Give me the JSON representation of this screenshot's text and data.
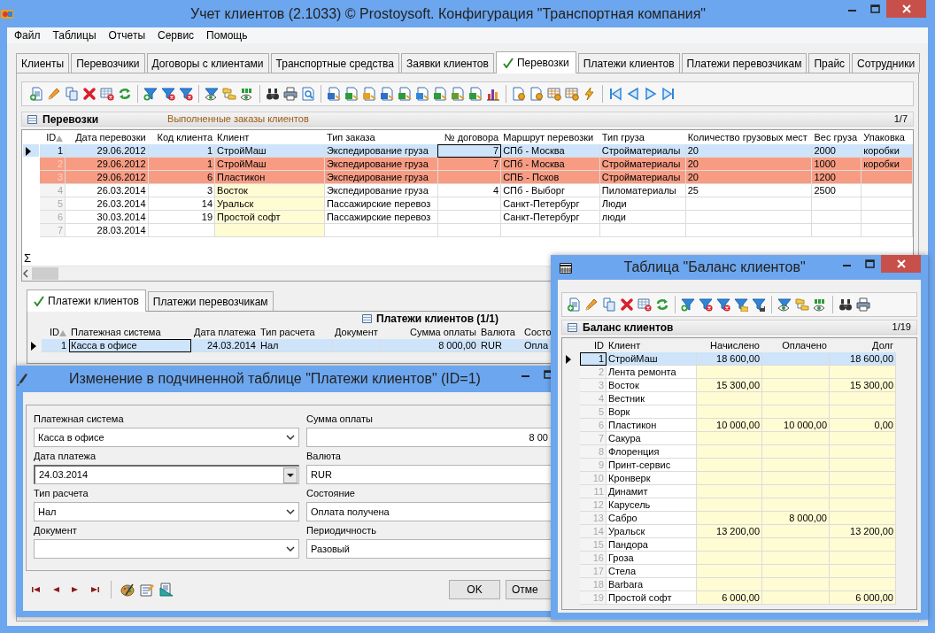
{
  "main_window": {
    "title": "Учет клиентов (2.1033) © Prostoysoft. Конфигурация \"Транспортная компания\"",
    "menu": [
      "Файл",
      "Таблицы",
      "Отчеты",
      "Сервис",
      "Помощь"
    ],
    "tabs": [
      {
        "label": "Клиенты",
        "selected": false
      },
      {
        "label": "Перевозчики",
        "selected": false
      },
      {
        "label": "Договоры с клиентами",
        "selected": false
      },
      {
        "label": "Транспортные средства",
        "selected": false
      },
      {
        "label": "Заявки клиентов",
        "selected": false
      },
      {
        "label": "Перевозки",
        "selected": true
      },
      {
        "label": "Платежи клиентов",
        "selected": false
      },
      {
        "label": "Платежи перевозчикам",
        "selected": false
      },
      {
        "label": "Прайс",
        "selected": false
      },
      {
        "label": "Сотрудники",
        "selected": false
      }
    ],
    "panel": {
      "title": "Перевозки",
      "subtitle": "Выполненные заказы клиентов",
      "counter": "1/7"
    },
    "grid": {
      "columns": [
        {
          "label": "ID",
          "numeric": true,
          "highlight": false
        },
        {
          "label": "Дата перевозки",
          "numeric": true,
          "highlight": false
        },
        {
          "label": "Код клиента",
          "numeric": true,
          "highlight": false
        },
        {
          "label": "Клиент",
          "numeric": false,
          "highlight": true
        },
        {
          "label": "Тип заказа",
          "numeric": false,
          "highlight": false
        },
        {
          "label": "№ договора",
          "numeric": true,
          "highlight": false
        },
        {
          "label": "Маршрут перевозки",
          "numeric": false,
          "highlight": false
        },
        {
          "label": "Тип груза",
          "numeric": false,
          "highlight": false
        },
        {
          "label": "Количество грузовых мест",
          "numeric": false,
          "highlight": false
        },
        {
          "label": "Вес груза",
          "numeric": false,
          "highlight": false
        },
        {
          "label": "Упаковка",
          "numeric": false,
          "highlight": false
        }
      ],
      "rows": [
        {
          "cells": [
            "1",
            "29.06.2012",
            "1",
            "СтройМаш",
            "Экспедирование груза",
            "7",
            "СПб - Москва",
            "Стройматериалы",
            "20",
            "2000",
            "коробки"
          ],
          "selected": true
        },
        {
          "cells": [
            "2",
            "29.06.2012",
            "1",
            "СтройМаш",
            "Экспедирование груза",
            "7",
            "СПб - Москва",
            "Стройматериалы",
            "20",
            "1000",
            "коробки"
          ],
          "selected": false,
          "color": "#f79c83"
        },
        {
          "cells": [
            "3",
            "29.06.2012",
            "6",
            "Пластикон",
            "Экспедирование груза",
            "",
            "СПБ - Псков",
            "Стройматериалы",
            "20",
            "1200",
            ""
          ],
          "selected": false,
          "color": "#f79c83"
        },
        {
          "cells": [
            "4",
            "26.03.2014",
            "3",
            "Восток",
            "Экспедирование груза",
            "4",
            "СПб - Выборг",
            "Пиломатериалы",
            "25",
            "2500",
            ""
          ],
          "selected": false
        },
        {
          "cells": [
            "5",
            "26.03.2014",
            "14",
            "Уральск",
            "Пассажирские перевоз",
            "",
            "Санкт-Петербург",
            "Люди",
            "",
            "",
            ""
          ],
          "selected": false
        },
        {
          "cells": [
            "6",
            "30.03.2014",
            "19",
            "Простой софт",
            "Пассажирские перевоз",
            "",
            "Санкт-Петербург",
            "люди",
            "",
            "",
            ""
          ],
          "selected": false
        },
        {
          "cells": [
            "7",
            "28.03.2014",
            "",
            "",
            "",
            "",
            "",
            "",
            "",
            "",
            ""
          ],
          "selected": false
        }
      ],
      "sum_symbol": "Σ"
    },
    "sub_tabs": [
      {
        "label": "Платежи клиентов",
        "selected": true
      },
      {
        "label": "Платежи перевозчикам",
        "selected": false
      }
    ],
    "sub_grid": {
      "title": "Платежи клиентов (1/1)",
      "columns": [
        {
          "label": "ID",
          "numeric": true
        },
        {
          "label": "Платежная система",
          "numeric": false
        },
        {
          "label": "Дата платежа",
          "numeric": true
        },
        {
          "label": "Тип расчета",
          "numeric": false
        },
        {
          "label": "Документ",
          "numeric": false
        },
        {
          "label": "Сумма оплаты",
          "numeric": true
        },
        {
          "label": "Валюта",
          "numeric": false
        },
        {
          "label": "Состо",
          "numeric": false
        }
      ],
      "rows": [
        {
          "cells": [
            "1",
            "Касса в офисе",
            "24.03.2014",
            "Нал",
            "",
            "8 000,00",
            "RUR",
            "Опла"
          ],
          "selected": true
        }
      ]
    }
  },
  "dialog": {
    "title": "Изменение в подчиненной таблице \"Платежи клиентов\" (ID=1)",
    "fields": [
      {
        "label": "Платежная система",
        "value": "Касса в офисе",
        "kind": "select"
      },
      {
        "label": "Сумма оплаты",
        "value": "8 00",
        "kind": "number"
      },
      {
        "label": "Дата платежа",
        "value": "24.03.2014",
        "kind": "date"
      },
      {
        "label": "Валюта",
        "value": "RUR",
        "kind": "text"
      },
      {
        "label": "Тип расчета",
        "value": "Нал",
        "kind": "select"
      },
      {
        "label": "Состояние",
        "value": "Оплата получена",
        "kind": "text"
      },
      {
        "label": "Документ",
        "kind": "select"
      },
      {
        "label": "Периодичность",
        "value": "Разовый",
        "kind": "text"
      }
    ],
    "ok": "OK",
    "cancel": "Отме"
  },
  "balance_window": {
    "title": "Таблица \"Баланс клиентов\"",
    "panel_title": "Баланс клиентов",
    "counter": "1/19",
    "columns": [
      "ID",
      "Клиент",
      "Начислено",
      "Оплачено",
      "Долг"
    ],
    "rows": [
      {
        "cells": [
          "1",
          "СтройМаш",
          "18 600,00",
          "",
          "18 600,00"
        ],
        "selected": true
      },
      {
        "cells": [
          "2",
          "Лента ремонта",
          "",
          "",
          ""
        ],
        "selected": false
      },
      {
        "cells": [
          "3",
          "Восток",
          "15 300,00",
          "",
          "15 300,00"
        ],
        "selected": false
      },
      {
        "cells": [
          "4",
          "Вестник",
          "",
          "",
          ""
        ],
        "selected": false
      },
      {
        "cells": [
          "5",
          "Ворк",
          "",
          "",
          ""
        ],
        "selected": false
      },
      {
        "cells": [
          "6",
          "Пластикон",
          "10 000,00",
          "10 000,00",
          "0,00"
        ],
        "selected": false
      },
      {
        "cells": [
          "7",
          "Сакура",
          "",
          "",
          ""
        ],
        "selected": false
      },
      {
        "cells": [
          "8",
          "Флоренция",
          "",
          "",
          ""
        ],
        "selected": false
      },
      {
        "cells": [
          "9",
          "Принт-сервис",
          "",
          "",
          ""
        ],
        "selected": false
      },
      {
        "cells": [
          "10",
          "Кронверк",
          "",
          "",
          ""
        ],
        "selected": false
      },
      {
        "cells": [
          "11",
          "Динамит",
          "",
          "",
          ""
        ],
        "selected": false
      },
      {
        "cells": [
          "12",
          "Карусель",
          "",
          "",
          ""
        ],
        "selected": false
      },
      {
        "cells": [
          "13",
          "Сабро",
          "",
          "8 000,00",
          ""
        ],
        "selected": false
      },
      {
        "cells": [
          "14",
          "Уральск",
          "13 200,00",
          "",
          "13 200,00"
        ],
        "selected": false
      },
      {
        "cells": [
          "15",
          "Пандора",
          "",
          "",
          ""
        ],
        "selected": false
      },
      {
        "cells": [
          "16",
          "Гроза",
          "",
          "",
          ""
        ],
        "selected": false
      },
      {
        "cells": [
          "17",
          "Стела",
          "",
          "",
          ""
        ],
        "selected": false
      },
      {
        "cells": [
          "18",
          "Barbara",
          "",
          "",
          ""
        ],
        "selected": false
      },
      {
        "cells": [
          "19",
          "Простой софт",
          "6 000,00",
          "",
          "6 000,00"
        ],
        "selected": false
      }
    ]
  }
}
